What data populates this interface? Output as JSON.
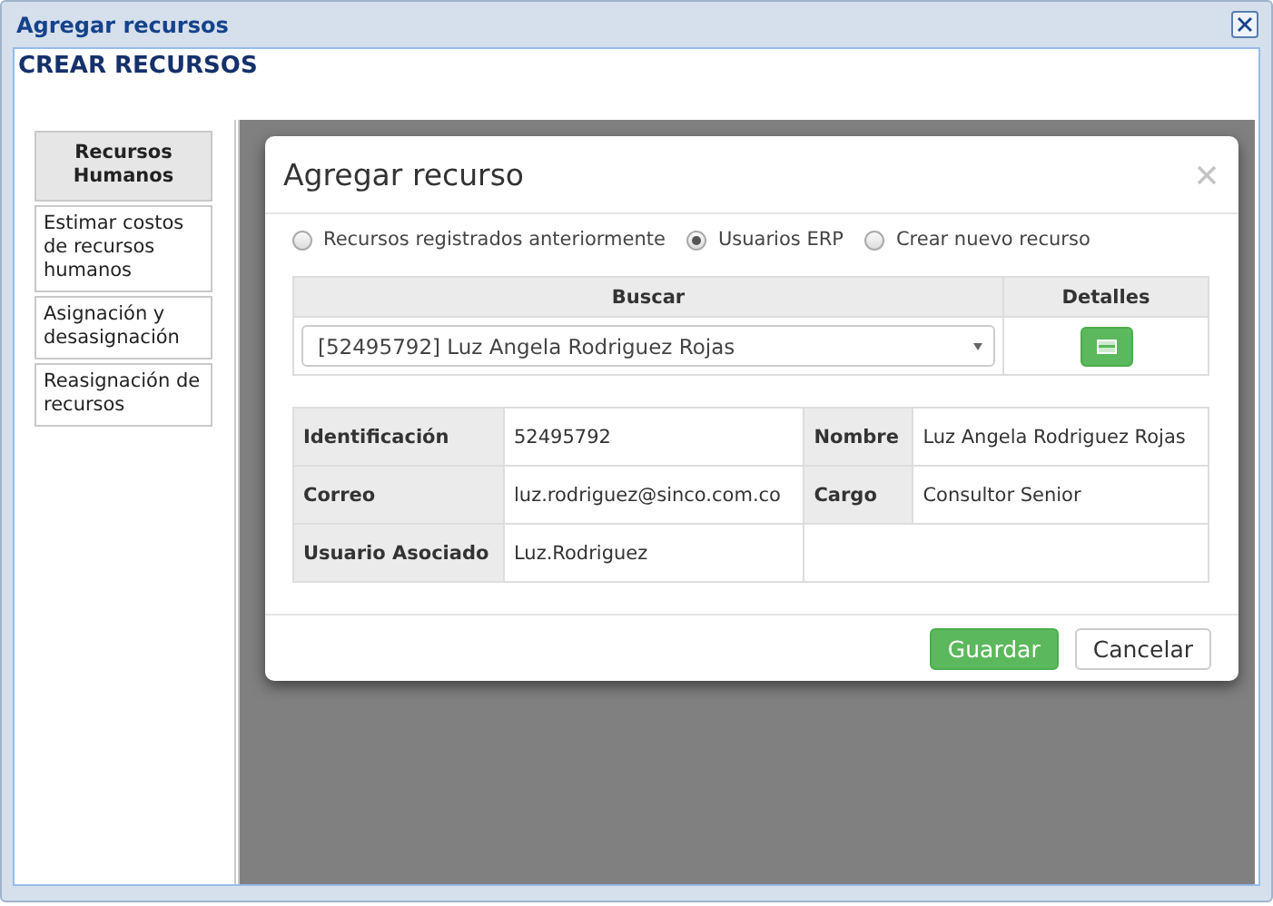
{
  "window": {
    "title": "Agregar recursos"
  },
  "page": {
    "heading": "CREAR RECURSOS"
  },
  "sidebar": {
    "items": [
      {
        "label": "Recursos Humanos",
        "selected": true
      },
      {
        "label": "Estimar costos de recursos humanos",
        "selected": false
      },
      {
        "label": "Asignación y desasignación",
        "selected": false
      },
      {
        "label": "Reasignación de recursos",
        "selected": false
      }
    ]
  },
  "dialog": {
    "title": "Agregar recurso",
    "source_options": [
      {
        "label": "Recursos registrados anteriormente",
        "selected": false
      },
      {
        "label": "Usuarios ERP",
        "selected": true
      },
      {
        "label": "Crear nuevo recurso",
        "selected": false
      }
    ],
    "search_table": {
      "columns": [
        "Buscar",
        "Detalles"
      ],
      "selected_value": "[52495792] Luz Angela Rodriguez Rojas"
    },
    "details": [
      [
        {
          "label": "Identificación",
          "value": "52495792"
        },
        {
          "label": "Nombre",
          "value": "Luz Angela Rodriguez Rojas"
        }
      ],
      [
        {
          "label": "Correo",
          "value": "luz.rodriguez@sinco.com.co"
        },
        {
          "label": "Cargo",
          "value": "Consultor Senior"
        }
      ],
      [
        {
          "label": "Usuario Asociado",
          "value": "Luz.Rodriguez"
        }
      ]
    ],
    "buttons": [
      {
        "label": "Guardar",
        "kind": "primary"
      },
      {
        "label": "Cancelar",
        "kind": "default"
      }
    ]
  }
}
